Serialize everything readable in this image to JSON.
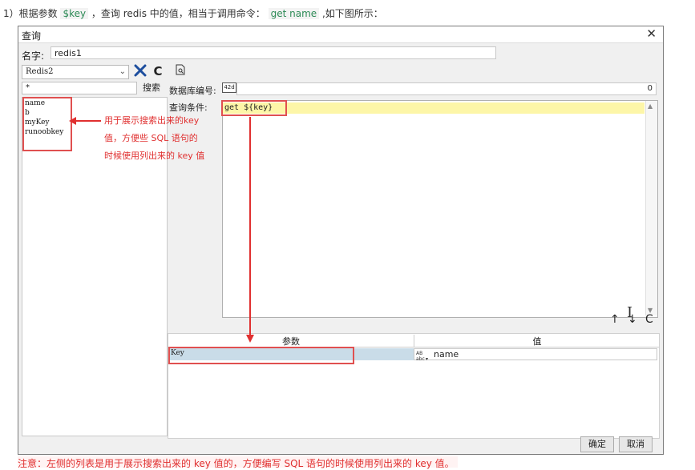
{
  "intro": {
    "prefix": "1）根据参数 ",
    "param": "$key",
    "middle": " ，查询 redis 中的值，相当于调用命令： ",
    "command": "get name",
    "suffix": " ,如下图所示："
  },
  "dialog": {
    "title": "查询",
    "close_icon": "close-icon",
    "name_label": "名字:",
    "name_value": "redis1",
    "connection": "Redis2",
    "toolbar_icons": [
      "wrench-icon",
      "refresh-icon",
      "preview-icon"
    ],
    "search_value": "*",
    "search_button": "搜索",
    "keys": [
      "name",
      "b",
      "myKey",
      "runoobkey"
    ],
    "db_label": "数据库编号:",
    "db_icon_text": "42d",
    "db_value": "0",
    "condition_label": "查询条件:",
    "condition_text": "get ${key}",
    "nav_icons": {
      "up": "↑",
      "down": "↓",
      "refresh": "C"
    },
    "params_header": {
      "param": "参数",
      "value": "值"
    },
    "params": [
      {
        "key": "Key",
        "value": "name",
        "type_icon": "abc-type-icon"
      }
    ],
    "ok_button": "确定",
    "cancel_button": "取消"
  },
  "annotation": {
    "line1": "用于展示搜索出来的key",
    "line2": "值，方便些 SQL 语句的",
    "line3": "时候使用列出来的 key 值"
  },
  "note": "注意：左侧的列表是用于展示搜索出来的 key 值的，方便编写 SQL 语句的时候使用列出来的 key 值。",
  "colors": {
    "annotation_red": "#e03030",
    "highlight_yellow": "#fdf6a8",
    "selected_row": "#c9dce8",
    "code_green": "#2e8b57"
  }
}
